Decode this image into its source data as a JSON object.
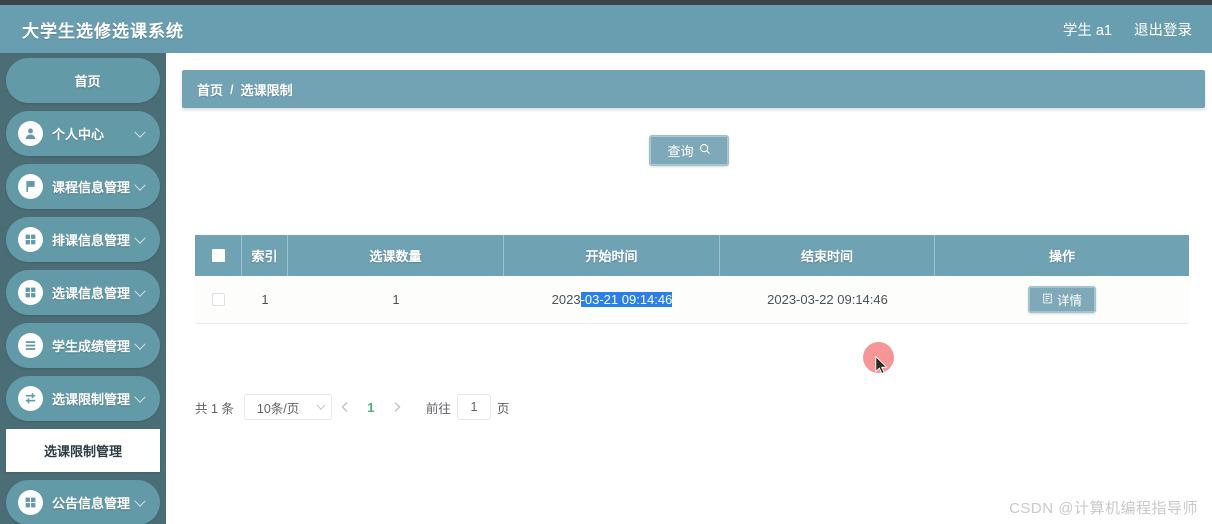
{
  "header": {
    "title": "大学生选修选课系统",
    "user_label": "学生 a1",
    "logout_label": "退出登录"
  },
  "sidebar": {
    "items": [
      {
        "label": "首页",
        "icon": "",
        "has_chevron": false
      },
      {
        "label": "个人中心",
        "icon": "user-icon",
        "has_chevron": true
      },
      {
        "label": "课程信息管理",
        "icon": "flag-icon",
        "has_chevron": true
      },
      {
        "label": "排课信息管理",
        "icon": "grid-icon",
        "has_chevron": true
      },
      {
        "label": "选课信息管理",
        "icon": "grid-icon",
        "has_chevron": true
      },
      {
        "label": "学生成绩管理",
        "icon": "list-icon",
        "has_chevron": true
      },
      {
        "label": "选课限制管理",
        "icon": "sliders-icon",
        "has_chevron": true
      },
      {
        "label": "公告信息管理",
        "icon": "grid-icon",
        "has_chevron": true
      }
    ],
    "submenu": {
      "label": "选课限制管理",
      "after_index": 6
    }
  },
  "breadcrumb": {
    "home": "首页",
    "separator": "/",
    "current": "选课限制"
  },
  "toolbar": {
    "query_label": "查询",
    "query_icon": "search-icon"
  },
  "table": {
    "columns": [
      {
        "key": "check",
        "label": "",
        "icon": "select-all-checkbox"
      },
      {
        "key": "index",
        "label": "索引"
      },
      {
        "key": "count",
        "label": "选课数量"
      },
      {
        "key": "start",
        "label": "开始时间"
      },
      {
        "key": "end",
        "label": "结束时间"
      },
      {
        "key": "op",
        "label": "操作"
      }
    ],
    "rows": [
      {
        "index": "1",
        "count": "1",
        "start_unselected": "2023",
        "start_selected": "-03-21 09:14:46",
        "start_full": "2023-03-21 09:14:46",
        "end": "2023-03-22 09:14:46",
        "detail_label": "详情",
        "detail_icon": "document-icon",
        "checked": false
      }
    ]
  },
  "pagination": {
    "total_text": "共 1 条",
    "page_size": "10条/页",
    "prev_icon": "chevron-left-icon",
    "next_icon": "chevron-right-icon",
    "current_page": "1",
    "goto_label": "前往",
    "goto_value": "1",
    "page_unit": "页"
  },
  "watermark": {
    "text": "CSDN @计算机编程指导师"
  },
  "colors": {
    "header_bg": "#699eb0",
    "sidebar_bg": "#4b6d75",
    "menu_pill": "#639aa8",
    "accent": "#72a3b4",
    "table_head": "#6fa2b3",
    "selection_blue": "#2a7fe8",
    "page_green": "#4caf7d",
    "cursor_dot": "#f37878"
  }
}
